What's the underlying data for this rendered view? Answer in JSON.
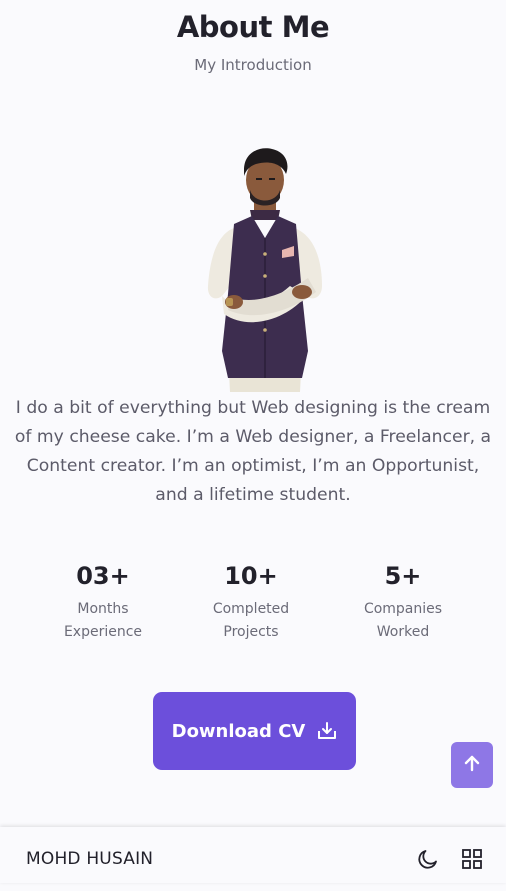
{
  "about": {
    "title": "About Me",
    "subtitle": "My Introduction",
    "description_lines": [
      "I do a bit of everything but Web designing is the cream",
      "of my cheese cake. I’m a Web designer, a Freelancer, a",
      "Content creator. I’m an optimist, I’m an Opportunist,",
      "and a lifetime student."
    ],
    "stats": [
      {
        "value": "03+",
        "label_line1": "Months",
        "label_line2": "Experience"
      },
      {
        "value": "10+",
        "label_line1": "Completed",
        "label_line2": "Projects"
      },
      {
        "value": "5+",
        "label_line1": "Companies",
        "label_line2": "Worked"
      }
    ],
    "download_label": "Download CV"
  },
  "footer": {
    "logo": "MOHD HUSAIN"
  },
  "icons": {
    "download": "download-icon",
    "scroll_up": "arrow-up-icon",
    "theme": "moon-icon",
    "menu": "grid-icon"
  },
  "colors": {
    "accent": "#6c4fdb",
    "scroll_button": "#8e77e6",
    "background": "#fafafd",
    "title": "#22212b",
    "text": "#6b6b78"
  }
}
